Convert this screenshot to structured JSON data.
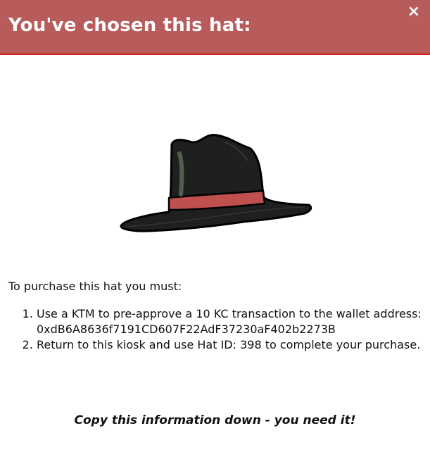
{
  "colors": {
    "header_background": "#b85b5b",
    "header_border": "#d11f1f",
    "title_text": "#ffffff",
    "hat_crown": "#222222",
    "hat_band": "#c0504d"
  },
  "modal": {
    "title": "You've chosen this hat:",
    "close_icon": "close-icon"
  },
  "hat": {
    "icon": "fedora-hat-icon",
    "hat_id": "398"
  },
  "instructions": {
    "intro": "To purchase this hat you must:",
    "step1_text": "Use a KTM to pre-approve a 10 KC transaction to the wallet address:",
    "wallet_address": "0xdB6A8636f7191CD607F22AdF37230aF402b2273B",
    "step2_text": "Return to this kiosk and use Hat ID: 398 to complete your purchase."
  },
  "note": "Copy this information down - you need it!"
}
